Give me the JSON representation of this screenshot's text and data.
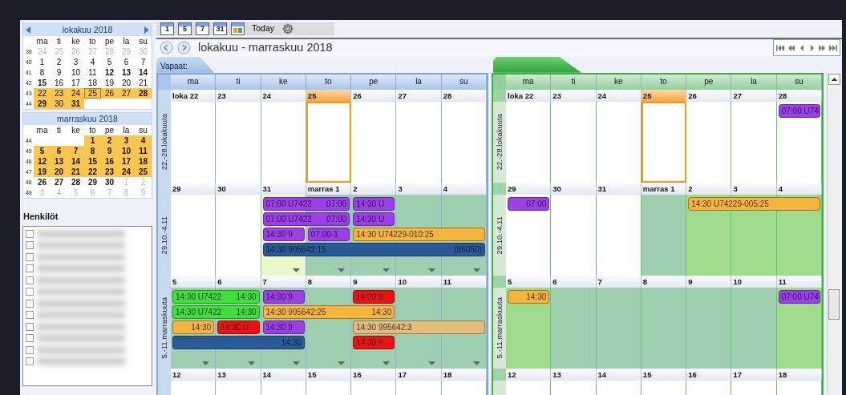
{
  "sidebar": {
    "calendars": [
      {
        "title": "lokakuu 2018",
        "arrows": true,
        "weekdays": [
          "ma",
          "ti",
          "ke",
          "to",
          "pe",
          "la",
          "su"
        ],
        "weeks": [
          {
            "number": "39",
            "days": [
              {
                "kind": "day",
                "t": "24",
                "muted": true,
                "bold": false,
                "highlighted": false,
                "today": false
              },
              {
                "kind": "day",
                "t": "25",
                "muted": true,
                "bold": false,
                "highlighted": false,
                "today": false
              },
              {
                "kind": "day",
                "t": "26",
                "muted": true,
                "bold": false,
                "highlighted": false,
                "today": false
              },
              {
                "kind": "day",
                "t": "27",
                "muted": true,
                "bold": false,
                "highlighted": false,
                "today": false
              },
              {
                "kind": "day",
                "t": "28",
                "muted": true,
                "bold": false,
                "highlighted": false,
                "today": false
              },
              {
                "kind": "day",
                "t": "29",
                "muted": true,
                "bold": false,
                "highlighted": false,
                "today": false
              },
              {
                "kind": "day",
                "t": "30",
                "muted": true,
                "bold": false,
                "highlighted": false,
                "today": false
              }
            ]
          },
          {
            "number": "40",
            "days": [
              {
                "kind": "day",
                "t": "1",
                "muted": false,
                "bold": false,
                "highlighted": false,
                "today": false
              },
              {
                "kind": "day",
                "t": "2",
                "muted": false,
                "bold": false,
                "highlighted": false,
                "today": false
              },
              {
                "kind": "day",
                "t": "3",
                "muted": false,
                "bold": false,
                "highlighted": false,
                "today": false
              },
              {
                "kind": "day",
                "t": "4",
                "muted": false,
                "bold": false,
                "highlighted": false,
                "today": false
              },
              {
                "kind": "day",
                "t": "5",
                "muted": false,
                "bold": false,
                "highlighted": false,
                "today": false
              },
              {
                "kind": "day",
                "t": "6",
                "muted": false,
                "bold": false,
                "highlighted": false,
                "today": false
              },
              {
                "kind": "day",
                "t": "7",
                "muted": false,
                "bold": false,
                "highlighted": false,
                "today": false
              }
            ]
          },
          {
            "number": "41",
            "days": [
              {
                "kind": "day",
                "t": "8",
                "muted": false,
                "bold": false,
                "highlighted": false,
                "today": false
              },
              {
                "kind": "day",
                "t": "9",
                "muted": false,
                "bold": false,
                "highlighted": false,
                "today": false
              },
              {
                "kind": "day",
                "t": "10",
                "muted": false,
                "bold": false,
                "highlighted": false,
                "today": false
              },
              {
                "kind": "day",
                "t": "11",
                "muted": false,
                "bold": false,
                "highlighted": false,
                "today": false
              },
              {
                "kind": "day",
                "t": "12",
                "muted": false,
                "bold": true,
                "highlighted": false,
                "today": false
              },
              {
                "kind": "day",
                "t": "13",
                "muted": false,
                "bold": true,
                "highlighted": false,
                "today": false
              },
              {
                "kind": "day",
                "t": "14",
                "muted": false,
                "bold": true,
                "highlighted": false,
                "today": false
              }
            ]
          },
          {
            "number": "42",
            "days": [
              {
                "kind": "day",
                "t": "15",
                "muted": false,
                "bold": true,
                "highlighted": false,
                "today": false
              },
              {
                "kind": "day",
                "t": "16",
                "muted": false,
                "bold": false,
                "highlighted": false,
                "today": false
              },
              {
                "kind": "day",
                "t": "17",
                "muted": false,
                "bold": false,
                "highlighted": false,
                "today": false
              },
              {
                "kind": "day",
                "t": "18",
                "muted": false,
                "bold": false,
                "highlighted": false,
                "today": false
              },
              {
                "kind": "day",
                "t": "19",
                "muted": false,
                "bold": false,
                "highlighted": false,
                "today": false
              },
              {
                "kind": "day",
                "t": "20",
                "muted": false,
                "bold": false,
                "highlighted": false,
                "today": false
              },
              {
                "kind": "day",
                "t": "21",
                "muted": false,
                "bold": false,
                "highlighted": false,
                "today": false
              }
            ]
          },
          {
            "number": "43",
            "days": [
              {
                "kind": "day",
                "t": "22",
                "muted": false,
                "bold": false,
                "highlighted": true,
                "today": false
              },
              {
                "kind": "day",
                "t": "23",
                "muted": false,
                "bold": false,
                "highlighted": true,
                "today": false
              },
              {
                "kind": "day",
                "t": "24",
                "muted": false,
                "bold": false,
                "highlighted": true,
                "today": false
              },
              {
                "kind": "day",
                "t": "25",
                "muted": false,
                "bold": false,
                "highlighted": true,
                "today": true
              },
              {
                "kind": "day",
                "t": "26",
                "muted": false,
                "bold": false,
                "highlighted": true,
                "today": false
              },
              {
                "kind": "day",
                "t": "27",
                "muted": false,
                "bold": false,
                "highlighted": true,
                "today": false
              },
              {
                "kind": "day",
                "t": "28",
                "muted": false,
                "bold": true,
                "highlighted": true,
                "today": false
              }
            ]
          },
          {
            "number": "44",
            "days": [
              {
                "kind": "day",
                "t": "29",
                "muted": false,
                "bold": true,
                "highlighted": true,
                "today": false
              },
              {
                "kind": "day",
                "t": "30",
                "muted": false,
                "bold": false,
                "highlighted": true,
                "today": false
              },
              {
                "kind": "day",
                "t": "31",
                "muted": false,
                "bold": true,
                "highlighted": true,
                "today": false
              },
              {
                "kind": "blank"
              },
              {
                "kind": "blank"
              },
              {
                "kind": "blank"
              },
              {
                "kind": "blank"
              }
            ]
          }
        ]
      },
      {
        "title": "marraskuu 2018",
        "arrows": false,
        "weekdays": [
          "ma",
          "ti",
          "ke",
          "to",
          "pe",
          "la",
          "su"
        ],
        "weeks": [
          {
            "number": "44",
            "days": [
              {
                "kind": "blank"
              },
              {
                "kind": "blank"
              },
              {
                "kind": "blank"
              },
              {
                "kind": "day",
                "t": "1",
                "muted": false,
                "bold": true,
                "highlighted": true,
                "today": false
              },
              {
                "kind": "day",
                "t": "2",
                "muted": false,
                "bold": true,
                "highlighted": true,
                "today": false
              },
              {
                "kind": "day",
                "t": "3",
                "muted": false,
                "bold": true,
                "highlighted": true,
                "today": false
              },
              {
                "kind": "day",
                "t": "4",
                "muted": false,
                "bold": true,
                "highlighted": true,
                "today": false
              }
            ]
          },
          {
            "number": "45",
            "days": [
              {
                "kind": "day",
                "t": "5",
                "muted": false,
                "bold": true,
                "highlighted": true,
                "today": false
              },
              {
                "kind": "day",
                "t": "6",
                "muted": false,
                "bold": true,
                "highlighted": true,
                "today": false
              },
              {
                "kind": "day",
                "t": "7",
                "muted": false,
                "bold": true,
                "highlighted": true,
                "today": false
              },
              {
                "kind": "day",
                "t": "8",
                "muted": false,
                "bold": true,
                "highlighted": true,
                "today": false
              },
              {
                "kind": "day",
                "t": "9",
                "muted": false,
                "bold": true,
                "highlighted": true,
                "today": false
              },
              {
                "kind": "day",
                "t": "10",
                "muted": false,
                "bold": true,
                "highlighted": true,
                "today": false
              },
              {
                "kind": "day",
                "t": "11",
                "muted": false,
                "bold": true,
                "highlighted": true,
                "today": false
              }
            ]
          },
          {
            "number": "46",
            "days": [
              {
                "kind": "day",
                "t": "12",
                "muted": false,
                "bold": true,
                "highlighted": true,
                "today": false
              },
              {
                "kind": "day",
                "t": "13",
                "muted": false,
                "bold": true,
                "highlighted": true,
                "today": false
              },
              {
                "kind": "day",
                "t": "14",
                "muted": false,
                "bold": true,
                "highlighted": true,
                "today": false
              },
              {
                "kind": "day",
                "t": "15",
                "muted": false,
                "bold": true,
                "highlighted": true,
                "today": false
              },
              {
                "kind": "day",
                "t": "16",
                "muted": false,
                "bold": true,
                "highlighted": true,
                "today": false
              },
              {
                "kind": "day",
                "t": "17",
                "muted": false,
                "bold": true,
                "highlighted": true,
                "today": false
              },
              {
                "kind": "day",
                "t": "18",
                "muted": false,
                "bold": true,
                "highlighted": true,
                "today": false
              }
            ]
          },
          {
            "number": "47",
            "days": [
              {
                "kind": "day",
                "t": "19",
                "muted": false,
                "bold": true,
                "highlighted": true,
                "today": false
              },
              {
                "kind": "day",
                "t": "20",
                "muted": false,
                "bold": true,
                "highlighted": true,
                "today": false
              },
              {
                "kind": "day",
                "t": "21",
                "muted": false,
                "bold": true,
                "highlighted": true,
                "today": false
              },
              {
                "kind": "day",
                "t": "22",
                "muted": false,
                "bold": true,
                "highlighted": true,
                "today": false
              },
              {
                "kind": "day",
                "t": "23",
                "muted": false,
                "bold": true,
                "highlighted": true,
                "today": false
              },
              {
                "kind": "day",
                "t": "24",
                "muted": false,
                "bold": true,
                "highlighted": true,
                "today": false
              },
              {
                "kind": "day",
                "t": "25",
                "muted": false,
                "bold": true,
                "highlighted": true,
                "today": false
              }
            ]
          },
          {
            "number": "48",
            "days": [
              {
                "kind": "day",
                "t": "26",
                "muted": false,
                "bold": true,
                "highlighted": false,
                "today": false
              },
              {
                "kind": "day",
                "t": "27",
                "muted": false,
                "bold": true,
                "highlighted": false,
                "today": false
              },
              {
                "kind": "day",
                "t": "28",
                "muted": false,
                "bold": true,
                "highlighted": false,
                "today": false
              },
              {
                "kind": "day",
                "t": "29",
                "muted": false,
                "bold": true,
                "highlighted": false,
                "today": false
              },
              {
                "kind": "day",
                "t": "30",
                "muted": false,
                "bold": true,
                "highlighted": false,
                "today": false
              },
              {
                "kind": "day",
                "t": "1",
                "muted": true,
                "bold": false,
                "highlighted": false,
                "today": false
              },
              {
                "kind": "day",
                "t": "2",
                "muted": true,
                "bold": false,
                "highlighted": false,
                "today": false
              }
            ]
          },
          {
            "number": "49",
            "days": [
              {
                "kind": "day",
                "t": "3",
                "muted": true,
                "bold": false,
                "highlighted": false,
                "today": false
              },
              {
                "kind": "day",
                "t": "4",
                "muted": true,
                "bold": false,
                "highlighted": false,
                "today": false
              },
              {
                "kind": "day",
                "t": "5",
                "muted": true,
                "bold": false,
                "highlighted": false,
                "today": false
              },
              {
                "kind": "day",
                "t": "6",
                "muted": true,
                "bold": false,
                "highlighted": false,
                "today": false
              },
              {
                "kind": "day",
                "t": "7",
                "muted": true,
                "bold": false,
                "highlighted": false,
                "today": false
              },
              {
                "kind": "day",
                "t": "8",
                "muted": true,
                "bold": false,
                "highlighted": false,
                "today": false
              },
              {
                "kind": "day",
                "t": "9",
                "muted": true,
                "bold": false,
                "highlighted": false,
                "today": false
              }
            ]
          }
        ]
      }
    ],
    "people_title": "Henkilöt",
    "people": [
      {
        "checked": false
      },
      {
        "checked": false
      },
      {
        "checked": false
      },
      {
        "checked": false
      },
      {
        "checked": false
      },
      {
        "checked": false
      },
      {
        "checked": false
      },
      {
        "checked": false
      },
      {
        "checked": false
      },
      {
        "checked": false
      },
      {
        "checked": false
      },
      {
        "checked": false
      }
    ]
  },
  "toolbar": {
    "view_buttons": [
      {
        "kind": "number",
        "text": "1"
      },
      {
        "kind": "number",
        "text": "5"
      },
      {
        "kind": "number",
        "text": "7"
      },
      {
        "kind": "number",
        "text": "31"
      },
      {
        "kind": "picture"
      }
    ],
    "today": "Today"
  },
  "title": "lokakuu - marraskuu 2018",
  "panels": [
    {
      "kind": "blue",
      "tab": "Vapaat:",
      "weekdays": [
        "ma",
        "ti",
        "ke",
        "to",
        "pe",
        "la",
        "su"
      ],
      "weeks": [
        {
          "label": "22.-28.lokakuuta",
          "days": [
            {
              "date": "loka 22",
              "kind": "white",
              "today": false,
              "more": false
            },
            {
              "date": "23",
              "kind": "white",
              "today": false,
              "more": false
            },
            {
              "date": "24",
              "kind": "white",
              "today": false,
              "more": false
            },
            {
              "date": "25",
              "kind": "white",
              "today": true,
              "more": false
            },
            {
              "date": "26",
              "kind": "white",
              "today": false,
              "more": false
            },
            {
              "date": "27",
              "kind": "white",
              "today": false,
              "more": false
            },
            {
              "date": "28",
              "kind": "white",
              "today": false,
              "more": false
            }
          ]
        },
        {
          "label": "29.10.-4.11",
          "days": [
            {
              "date": "29",
              "kind": "white",
              "today": false,
              "more": false
            },
            {
              "date": "30",
              "kind": "white",
              "today": false,
              "more": false
            },
            {
              "date": "31",
              "kind": "lime",
              "today": false,
              "more": true
            },
            {
              "date": "marras 1",
              "kind": "teal",
              "today": false,
              "more": true
            },
            {
              "date": "2",
              "kind": "teal",
              "today": false,
              "more": true
            },
            {
              "date": "3",
              "kind": "teal",
              "today": false,
              "more": true
            },
            {
              "date": "4",
              "kind": "teal",
              "today": false,
              "more": true
            }
          ],
          "lanes": [
            [
              {
                "kind": "empty"
              },
              {
                "kind": "empty"
              },
              {
                "kind": "event",
                "color": "#9b3fe6",
                "text": "07:00 U7422",
                "end_text": "07:00"
              },
              {
                "kind": "cont"
              },
              {
                "kind": "event",
                "color": "#9b3fe6",
                "text": "14:30 U"
              },
              {
                "kind": "empty"
              },
              {
                "kind": "empty"
              }
            ],
            [
              {
                "kind": "empty"
              },
              {
                "kind": "empty"
              },
              {
                "kind": "event",
                "color": "#9b3fe6",
                "text": "07:00 U7422",
                "end_text": "07:00"
              },
              {
                "kind": "cont"
              },
              {
                "kind": "event",
                "color": "#9b3fe6",
                "text": "14:30 U"
              },
              {
                "kind": "empty"
              },
              {
                "kind": "empty"
              }
            ],
            [
              {
                "kind": "empty"
              },
              {
                "kind": "empty"
              },
              {
                "kind": "event",
                "color": "#9b3fe6",
                "text": "14:30 9"
              },
              {
                "kind": "event",
                "color": "#9b3fe6",
                "text": "07:00-1"
              },
              {
                "kind": "event",
                "color": "#f5b53d",
                "text": "14:30 U74229-010:25"
              },
              {
                "kind": "cont"
              },
              {
                "kind": "cont"
              }
            ],
            [
              {
                "kind": "empty"
              },
              {
                "kind": "empty"
              },
              {
                "kind": "event",
                "color": "#2a5a96",
                "text": "14:30 995642:15",
                "end_text": "(86050)"
              },
              {
                "kind": "cont"
              },
              {
                "kind": "cont"
              },
              {
                "kind": "cont"
              },
              {
                "kind": "cont"
              }
            ]
          ]
        },
        {
          "label": "5.-11.marraskuuta",
          "days": [
            {
              "date": "5",
              "kind": "teal",
              "today": false,
              "more": true
            },
            {
              "date": "6",
              "kind": "teal",
              "today": false,
              "more": true
            },
            {
              "date": "7",
              "kind": "teal",
              "today": false,
              "more": true
            },
            {
              "date": "8",
              "kind": "teal",
              "today": false,
              "more": true
            },
            {
              "date": "9",
              "kind": "teal",
              "today": false,
              "more": true
            },
            {
              "date": "10",
              "kind": "teal",
              "today": false,
              "more": true
            },
            {
              "date": "11",
              "kind": "teal",
              "today": false,
              "more": true
            }
          ],
          "lanes": [
            [
              {
                "kind": "event",
                "color": "#3fe03a",
                "text": "14:30 U7422",
                "end_text": "14:30"
              },
              {
                "kind": "cont"
              },
              {
                "kind": "event",
                "color": "#9b3fe6",
                "text": "14:30 9"
              },
              {
                "kind": "empty"
              },
              {
                "kind": "event",
                "color": "#ea1212",
                "text": "14:30 9"
              },
              {
                "kind": "empty"
              },
              {
                "kind": "empty"
              }
            ],
            [
              {
                "kind": "event",
                "color": "#3fe03a",
                "text": "14:30 U7422",
                "end_text": "14:30"
              },
              {
                "kind": "cont"
              },
              {
                "kind": "event",
                "color": "#f5b53d",
                "text": "14:30 995642:25",
                "end_text": "14:30"
              },
              {
                "kind": "cont"
              },
              {
                "kind": "cont"
              },
              {
                "kind": "empty"
              },
              {
                "kind": "empty"
              }
            ],
            [
              {
                "kind": "event",
                "color": "#f5b53d",
                "end_text": "14:30"
              },
              {
                "kind": "event",
                "color": "#ea1212",
                "text": "14:30 U"
              },
              {
                "kind": "event",
                "color": "#9b3fe6",
                "text": "14:30 9"
              },
              {
                "kind": "empty"
              },
              {
                "kind": "event",
                "color": "#e2bd7c",
                "text": "14:30 995642:3"
              },
              {
                "kind": "cont"
              },
              {
                "kind": "cont"
              }
            ],
            [
              {
                "kind": "event",
                "color": "#2a5a96",
                "end_text": "14:30"
              },
              {
                "kind": "cont"
              },
              {
                "kind": "cont"
              },
              {
                "kind": "empty"
              },
              {
                "kind": "event",
                "color": "#ea1212",
                "text": "14:30 9"
              },
              {
                "kind": "empty"
              },
              {
                "kind": "empty"
              }
            ]
          ]
        },
        {
          "days": [
            {
              "date": "12",
              "kind": "white",
              "today": false,
              "more": false
            },
            {
              "date": "13",
              "kind": "white",
              "today": false,
              "more": false
            },
            {
              "date": "14",
              "kind": "white",
              "today": false,
              "more": false
            },
            {
              "date": "15",
              "kind": "white",
              "today": false,
              "more": false
            },
            {
              "date": "16",
              "kind": "white",
              "today": false,
              "more": false
            },
            {
              "date": "17",
              "kind": "white",
              "today": false,
              "more": false
            },
            {
              "date": "18",
              "kind": "white",
              "today": false,
              "more": false
            }
          ]
        }
      ]
    },
    {
      "kind": "green",
      "weekdays": [
        "ma",
        "ti",
        "ke",
        "to",
        "pe",
        "la",
        "su"
      ],
      "weeks": [
        {
          "label": "22.-28.lokakuuta",
          "days": [
            {
              "date": "loka 22",
              "kind": "white",
              "today": false,
              "more": false
            },
            {
              "date": "23",
              "kind": "white",
              "today": false,
              "more": false
            },
            {
              "date": "24",
              "kind": "white",
              "today": false,
              "more": false
            },
            {
              "date": "25",
              "kind": "white",
              "today": true,
              "more": false
            },
            {
              "date": "26",
              "kind": "white",
              "today": false,
              "more": false
            },
            {
              "date": "27",
              "kind": "white",
              "today": false,
              "more": false
            },
            {
              "date": "28",
              "kind": "white",
              "today": false,
              "more": false
            }
          ],
          "lanes": [
            [
              {
                "kind": "empty"
              },
              {
                "kind": "empty"
              },
              {
                "kind": "empty"
              },
              {
                "kind": "empty"
              },
              {
                "kind": "empty"
              },
              {
                "kind": "empty"
              },
              {
                "kind": "event",
                "color": "#9b3fe6",
                "text": "07:00 U74"
              }
            ]
          ]
        },
        {
          "label": "29.10.-4.11",
          "days": [
            {
              "date": "29",
              "kind": "white",
              "today": false,
              "more": false
            },
            {
              "date": "30",
              "kind": "white",
              "today": false,
              "more": false
            },
            {
              "date": "31",
              "kind": "white",
              "today": false,
              "more": false
            },
            {
              "date": "marras 1",
              "kind": "teal",
              "today": false,
              "more": false
            },
            {
              "date": "2",
              "kind": "green",
              "today": false,
              "more": false
            },
            {
              "date": "3",
              "kind": "green",
              "today": false,
              "more": false
            },
            {
              "date": "4",
              "kind": "green",
              "today": false,
              "more": false
            }
          ],
          "lanes": [
            [
              {
                "kind": "event",
                "color": "#9b3fe6",
                "end_text": "07:00"
              },
              {
                "kind": "empty"
              },
              {
                "kind": "empty"
              },
              {
                "kind": "empty"
              },
              {
                "kind": "event",
                "color": "#f5b53d",
                "text": "14:30 U74229-005:25"
              },
              {
                "kind": "cont"
              },
              {
                "kind": "cont"
              }
            ]
          ]
        },
        {
          "label": "5.-11.marraskuuta",
          "days": [
            {
              "date": "5",
              "kind": "green",
              "today": false,
              "more": false
            },
            {
              "date": "6",
              "kind": "teal",
              "today": false,
              "more": false
            },
            {
              "date": "7",
              "kind": "teal",
              "today": false,
              "more": false
            },
            {
              "date": "8",
              "kind": "teal",
              "today": false,
              "more": false
            },
            {
              "date": "9",
              "kind": "teal",
              "today": false,
              "more": false
            },
            {
              "date": "10",
              "kind": "teal",
              "today": false,
              "more": false
            },
            {
              "date": "11",
              "kind": "green",
              "today": false,
              "more": false
            }
          ],
          "lanes": [
            [
              {
                "kind": "event",
                "color": "#f5b53d",
                "end_text": "14:30"
              },
              {
                "kind": "empty"
              },
              {
                "kind": "empty"
              },
              {
                "kind": "empty"
              },
              {
                "kind": "empty"
              },
              {
                "kind": "empty"
              },
              {
                "kind": "event",
                "color": "#9b3fe6",
                "text": "07:00 U74"
              }
            ]
          ]
        },
        {
          "days": [
            {
              "date": "12",
              "kind": "white",
              "today": false,
              "more": false
            },
            {
              "date": "13",
              "kind": "white",
              "today": false,
              "more": false
            },
            {
              "date": "14",
              "kind": "white",
              "today": false,
              "more": false
            },
            {
              "date": "15",
              "kind": "white",
              "today": false,
              "more": false
            },
            {
              "date": "16",
              "kind": "white",
              "today": false,
              "more": false
            },
            {
              "date": "17",
              "kind": "white",
              "today": false,
              "more": false
            },
            {
              "date": "18",
              "kind": "white",
              "today": false,
              "more": false
            }
          ]
        }
      ]
    }
  ]
}
